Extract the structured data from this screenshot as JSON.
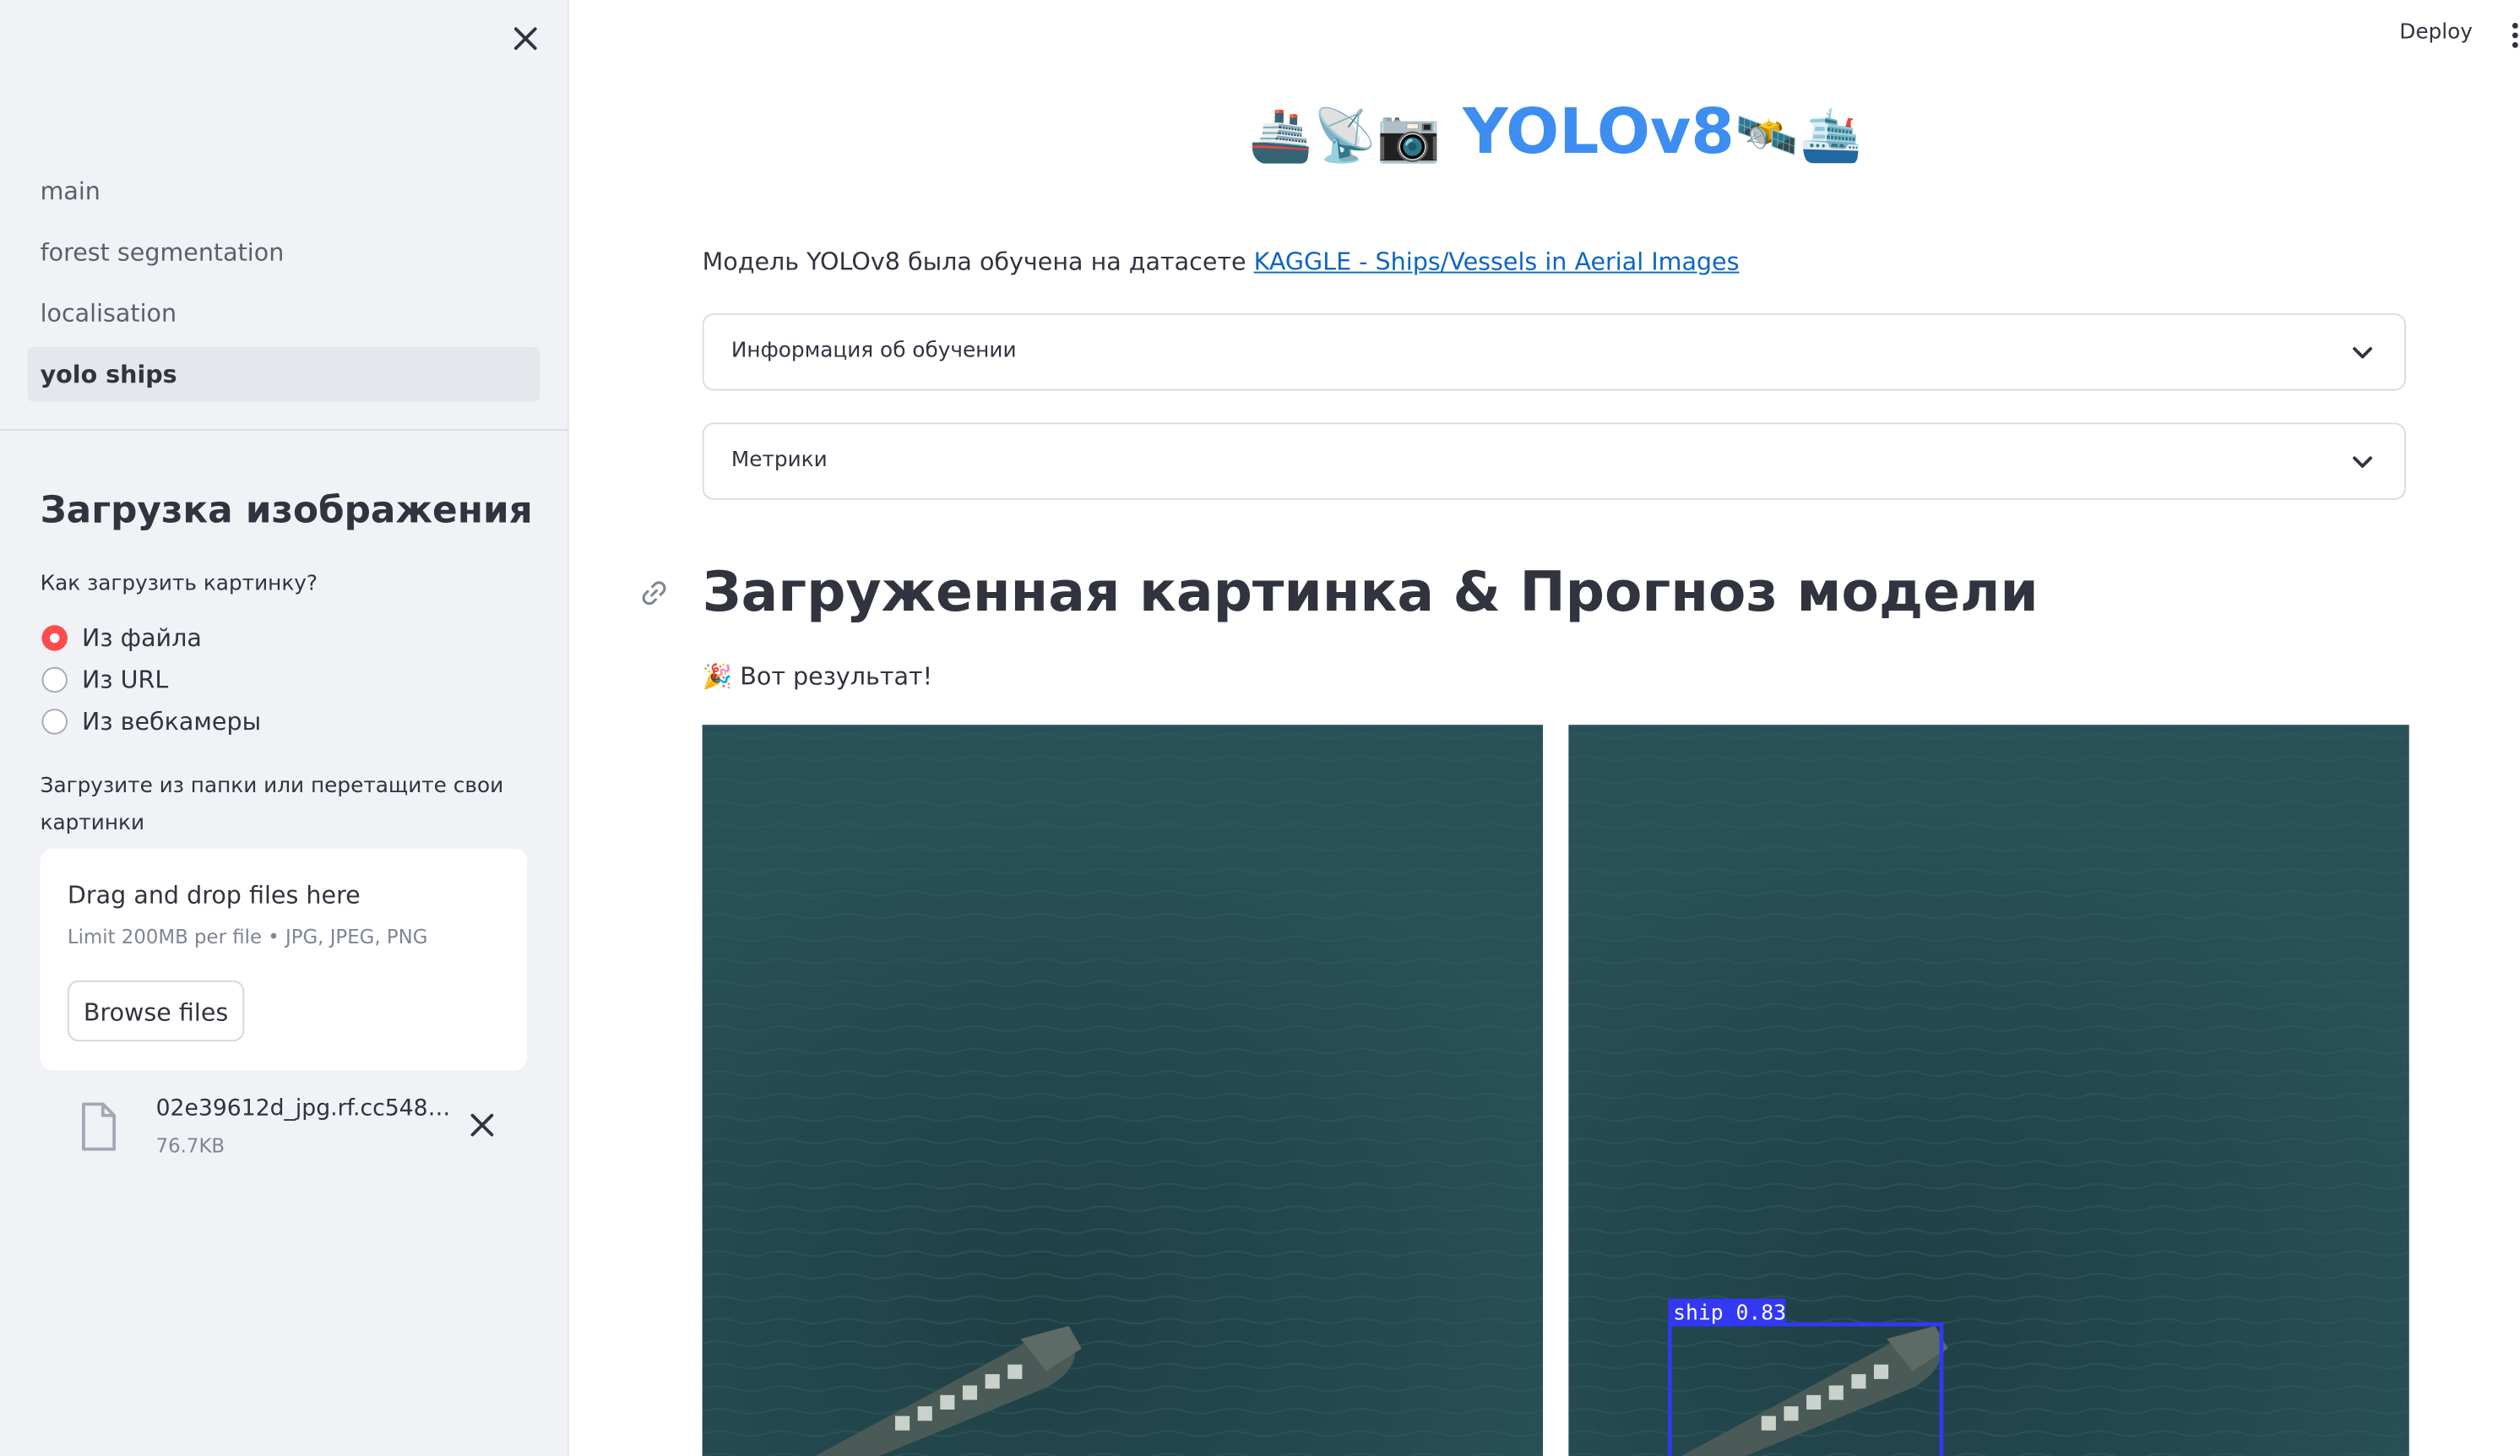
{
  "sidebar": {
    "nav_items": [
      {
        "label": "main"
      },
      {
        "label": "forest segmentation"
      },
      {
        "label": "localisation"
      },
      {
        "label": "yolo ships",
        "active": true
      }
    ],
    "upload_title": "Загрузка изображения",
    "source_question": "Как загрузить картинку?",
    "source_options": [
      "Из файла",
      "Из URL",
      "Из вебкамеры"
    ],
    "selected_source": "Из файла",
    "uploader_label": "Загрузите из папки или перетащите свои картинки",
    "drop_title": "Drag and drop files here",
    "drop_limit": "Limit 200MB per file • JPG, JPEG, PNG",
    "browse_label": "Browse files",
    "file": {
      "name": "02e39612d_jpg.rf.cc5483...",
      "size": "76.7KB"
    }
  },
  "topbar": {
    "deploy_label": "Deploy"
  },
  "main": {
    "title_left_emoji": "🚢📡📷",
    "title_text": "YOLOv8",
    "title_right_emoji": "🛰️🛳️",
    "intro_text": "Модель YOLOv8 была обучена на датасете ",
    "intro_link": "KAGGLE - Ships/Vessels in Aerial Images",
    "expanders": [
      "Информация об обучении",
      "Метрики"
    ],
    "section_heading": "Загруженная картинка & Прогноз модели",
    "result_emoji": "🎉",
    "result_text": "Вот результат!",
    "detection_label": "ship  0.83"
  },
  "colors": {
    "accent_red": "#ff4b4b",
    "title_blue": "#3d8ef0",
    "link_blue": "#0b66c3",
    "sea": "#25494f",
    "box_blue": "#3338f5"
  }
}
